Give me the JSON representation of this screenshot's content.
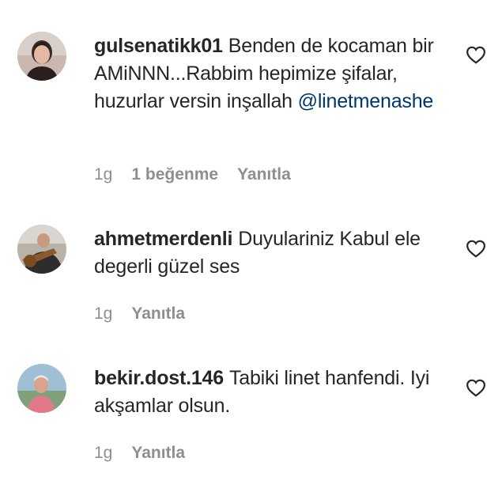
{
  "comments": [
    {
      "username": "gulsenatikk01",
      "text": "Benden de kocaman bir AMiNNN...Rabbim hepimize şifalar, huzurlar versin inşallah",
      "mention": "@linetmenashe",
      "time": "1g",
      "likes": "1 beğenme",
      "reply": "Yanıtla",
      "avatar_icon": "user-avatar-woman",
      "like_icon": "heart-outline-icon"
    },
    {
      "username": "ahmetmerdenli",
      "text": "Duyulariniz Kabul ele degerli güzel ses",
      "time": "1g",
      "reply": "Yanıtla",
      "avatar_icon": "user-avatar-guitarist",
      "like_icon": "heart-outline-icon"
    },
    {
      "username": "bekir.dost.146",
      "text": "Tabiki linet hanfendi. Iyi akşamlar olsun.",
      "time": "1g",
      "reply": "Yanıtla",
      "avatar_icon": "user-avatar-man",
      "like_icon": "heart-outline-icon"
    }
  ],
  "colors": {
    "text": "#262626",
    "secondary": "#8e8e8e",
    "mention": "#00376b"
  }
}
